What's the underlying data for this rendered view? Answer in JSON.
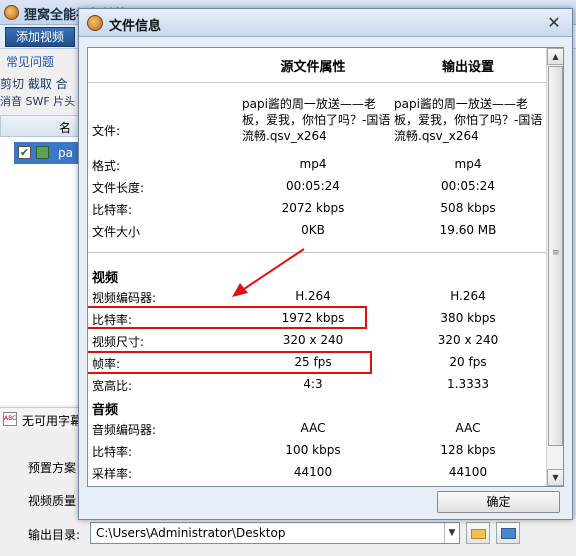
{
  "background": {
    "app_title": "狸窝全能视频转换器",
    "toolbar": {
      "add_video_label": "添加视频"
    },
    "faq_link": "常见问题",
    "edit_row": "剪切 截取 合",
    "edit_row2": "消音 SWF 片头",
    "list_header": "名",
    "list_item_text": "pa",
    "subtitle_text": "无可用字幕",
    "preset_label": "预置方案",
    "quality_label": "视频质量",
    "output_dir_label": "输出目录:",
    "output_dir_value": "C:\\Users\\Administrator\\Desktop"
  },
  "dialog": {
    "title": "文件信息",
    "close_label": "✕",
    "headers": {
      "source": "源文件属性",
      "output": "输出设置"
    },
    "file": {
      "label": "文件:",
      "source": "papi酱的周一放送——老板，爱我，你怕了吗？-国语流畅.qsv_x264",
      "output": "papi酱的周一放送——老板，爱我，你怕了吗？-国语流畅.qsv_x264"
    },
    "general_rows": [
      {
        "label": "格式:",
        "source": "mp4",
        "output": "mp4"
      },
      {
        "label": "文件长度:",
        "source": "00:05:24",
        "output": "00:05:24"
      },
      {
        "label": "比特率:",
        "source": "2072 kbps",
        "output": "508 kbps"
      },
      {
        "label": "文件大小",
        "source": "0KB",
        "output": "19.60 MB"
      }
    ],
    "video_section": "视频",
    "video_rows": [
      {
        "label": "视频编码器:",
        "source": "H.264",
        "output": "H.264"
      },
      {
        "label": "比特率:",
        "source": "1972 kbps",
        "output": "380 kbps"
      },
      {
        "label": "视频尺寸:",
        "source": "320 x 240",
        "output": "320 x 240"
      },
      {
        "label": "帧率:",
        "source": "25 fps",
        "output": "20 fps"
      },
      {
        "label": "宽高比:",
        "source": "4:3",
        "output": "1.3333"
      }
    ],
    "audio_section": "音频",
    "audio_rows": [
      {
        "label": "音频编码器:",
        "source": "AAC",
        "output": "AAC"
      },
      {
        "label": "比特率:",
        "source": "100 kbps",
        "output": "128 kbps"
      },
      {
        "label": "采样率:",
        "source": "44100",
        "output": "44100"
      }
    ],
    "ok_label": "确定"
  },
  "annotation_color": "#e01010"
}
